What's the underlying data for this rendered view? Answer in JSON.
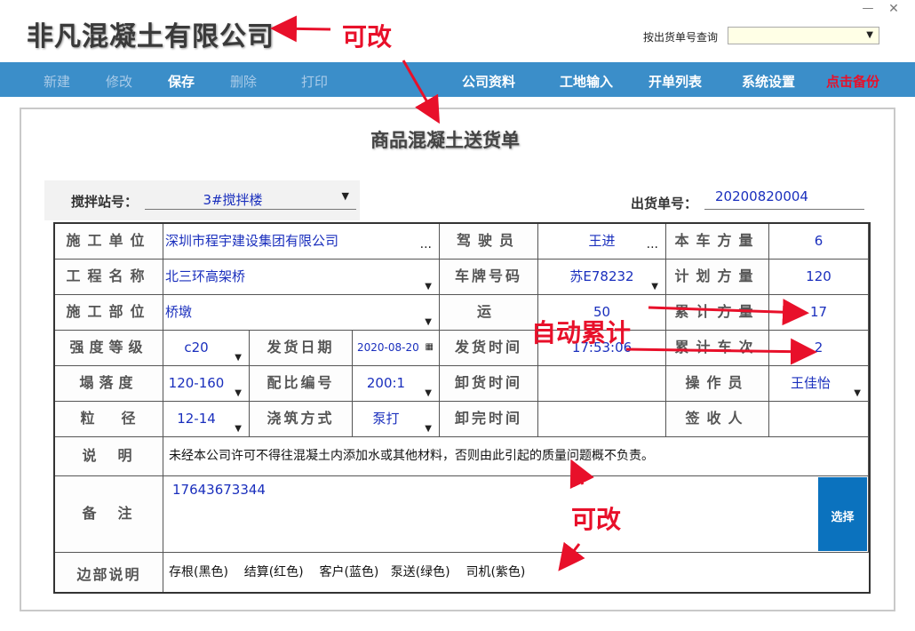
{
  "window": {
    "title": "非凡混凝土有限公司",
    "min_label": "—",
    "close_label": "✕"
  },
  "query": {
    "label": "按出货单号查询",
    "value": ""
  },
  "toolbar": {
    "new": "新建",
    "edit": "修改",
    "save": "保存",
    "delete": "删除",
    "print": "打印",
    "company": "公司资料",
    "site": "工地输入",
    "list": "开单列表",
    "settings": "系统设置",
    "backup": "点击备份"
  },
  "form": {
    "title": "商品混凝土送货单",
    "station_label": "搅拌站号：",
    "station_value": "3#搅拌楼",
    "ship_no_label": "出货单号：",
    "ship_no_value": "20200820004",
    "rows": {
      "unit_label": "施工单位",
      "unit_value": "深圳市程宇建设集团有限公司",
      "driver_label": "驾驶员",
      "driver_value": "王进",
      "car_vol_label": "本车方量",
      "car_vol_value": "6",
      "project_label": "工程名称",
      "project_value": "北三环高架桥",
      "plate_label": "车牌号码",
      "plate_value": "苏E78232",
      "plan_vol_label": "计划方量",
      "plan_vol_value": "120",
      "part_label": "施工部位",
      "part_value": "桥墩",
      "distance_label": "运距",
      "distance_value": "50",
      "cum_vol_label": "累计方量",
      "cum_vol_value": "17",
      "grade_label": "强度等级",
      "grade_value": "c20",
      "ship_date_label": "发货日期",
      "ship_date_value": "2020-08-20",
      "ship_time_label": "发货时间",
      "ship_time_value": "17:53:06",
      "cum_trips_label": "累计车次",
      "cum_trips_value": "2",
      "slump_label": "塌落度",
      "slump_value": "120-160",
      "mix_label": "配比编号",
      "mix_value": "200:1",
      "unload_label": "卸货时间",
      "unload_value": "",
      "operator_label": "操作员",
      "operator_value": "王佳怡",
      "size_label": "粒径",
      "size_value": "12-14",
      "pour_label": "浇筑方式",
      "pour_value": "泵打",
      "unload_end_label": "卸完时间",
      "unload_end_value": "",
      "signer_label": "签收人",
      "signer_value": "",
      "note_label": "说明",
      "note_value": "未经本公司许可不得往混凝土内添加水或其他材料，否则由此引起的质量问题概不负责。",
      "remark_label": "备注",
      "remark_value": "17643673344",
      "select_label": "选择",
      "margin_label": "边部说明",
      "margin_value": "存根(黑色)    结算(红色)    客户(蓝色)   泵送(绿色)    司机(紫色)"
    }
  },
  "annotations": {
    "editable_1": "可改",
    "auto_sum": "自动累计",
    "editable_2": "可改"
  },
  "colors": {
    "toolbar": "#3b8ec9",
    "value_text": "#1a2fbd",
    "backup": "#e8102a",
    "annotation": "#e8102a",
    "select_button": "#0b72be"
  }
}
